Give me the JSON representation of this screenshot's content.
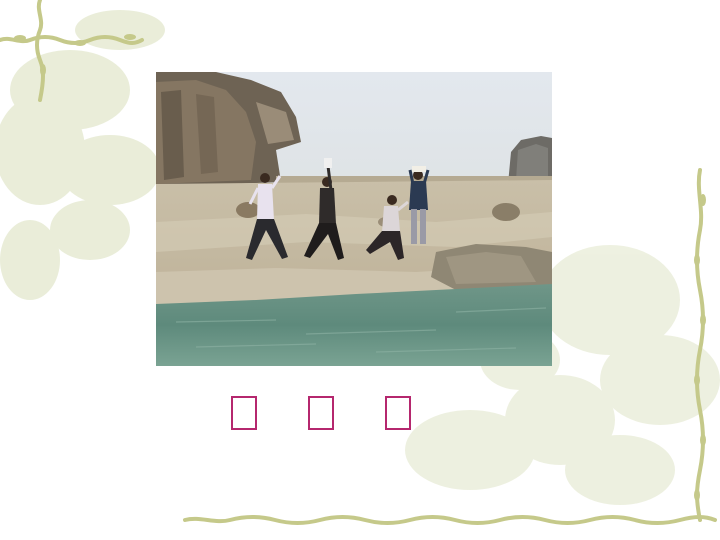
{
  "slide": {
    "caption_glyphs": [
      "□",
      "□",
      "□"
    ],
    "caption_color": "#b5276e",
    "vine_color": "#c9cc8a",
    "background_floral_color": "#e6ead2"
  },
  "photo": {
    "scene": "photo-people-on-rocky-shore",
    "figures": [
      {
        "name": "person-white-shirt"
      },
      {
        "name": "person-dark-clothes"
      },
      {
        "name": "person-crouching"
      },
      {
        "name": "person-standing-back"
      }
    ]
  }
}
